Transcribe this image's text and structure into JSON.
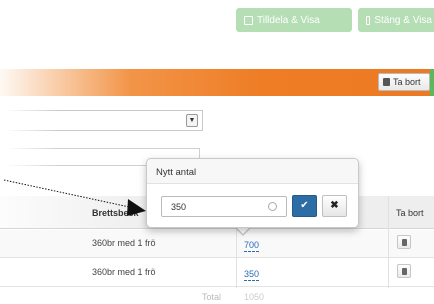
{
  "toolbar": {
    "button_1_label": "Tilldela & Visa",
    "button_2_label": "Stäng & Visa"
  },
  "header": {
    "delete_label": "Ta bort"
  },
  "table": {
    "columns": {
      "description": "Brettsbeck",
      "delete": "Ta bort"
    },
    "rows": [
      {
        "description": "360br med 1 frö",
        "quantity": "700"
      },
      {
        "description": "360br med 1 frö",
        "quantity": "350"
      }
    ],
    "sum_label": "Total",
    "sum_value": "1050"
  },
  "popover": {
    "title": "Nytt antal",
    "input_value": "350",
    "ok_symbol": "✔",
    "cancel_symbol": "✖"
  },
  "icons": {
    "dropdown": "caret-down-icon",
    "trash": "trash-icon",
    "check": "check-icon",
    "close": "close-icon",
    "clear": "clear-icon"
  },
  "colors": {
    "accent_orange": "#ee7d26",
    "primary_blue": "#2c6da6",
    "link_blue": "#2a6db0",
    "success_green": "#5cb85c"
  }
}
